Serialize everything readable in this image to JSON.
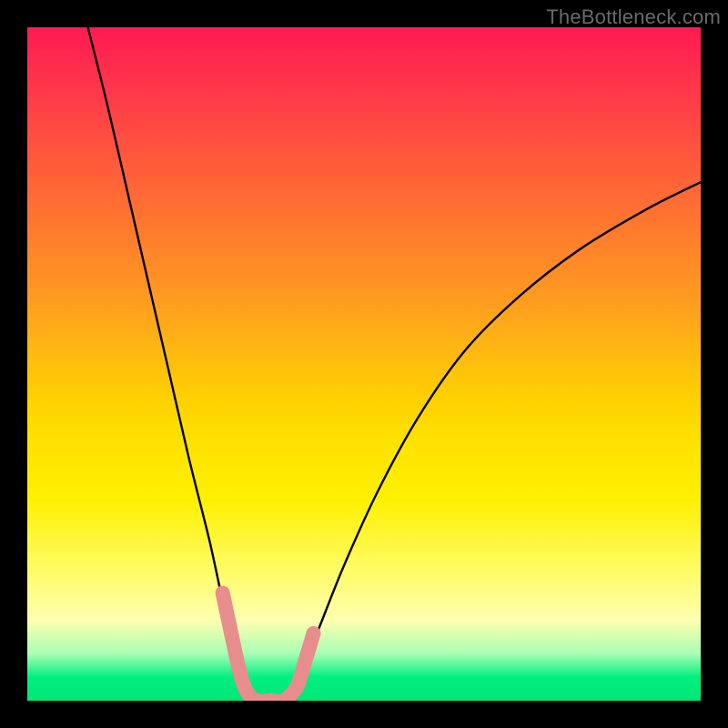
{
  "watermark": "TheBottleneck.com",
  "chart_data": {
    "type": "line",
    "title": "",
    "xlabel": "",
    "ylabel": "",
    "xlim": [
      0,
      100
    ],
    "ylim": [
      0,
      100
    ],
    "grid": false,
    "series": [
      {
        "name": "bottleneck-curve",
        "x": [
          9,
          12,
          15,
          18,
          21,
          24,
          27,
          29,
          31,
          32.5,
          34,
          36,
          38,
          40,
          43,
          47,
          52,
          58,
          65,
          73,
          82,
          92,
          100
        ],
        "y": [
          100,
          88,
          75,
          62,
          49,
          36,
          24,
          15,
          8,
          3,
          0,
          0,
          0,
          3,
          10,
          20,
          31,
          42,
          52,
          60,
          67,
          73,
          77
        ]
      }
    ],
    "highlight_segment": {
      "name": "near-zero-band",
      "x": [
        29,
        30.5,
        31.5,
        32.5,
        34,
        36,
        38,
        40,
        41,
        42.5
      ],
      "y": [
        16,
        9,
        4.5,
        1.5,
        0,
        0,
        0,
        2,
        5,
        10
      ],
      "color": "#e88d8d",
      "stroke_width_px": 16
    },
    "background_gradient": {
      "stops": [
        {
          "pos": 0.0,
          "color": "#ff1a52"
        },
        {
          "pos": 0.55,
          "color": "#ffd000"
        },
        {
          "pos": 0.88,
          "color": "#ffffb0"
        },
        {
          "pos": 0.965,
          "color": "#00ef80"
        },
        {
          "pos": 1.0,
          "color": "#00e678"
        }
      ]
    }
  }
}
